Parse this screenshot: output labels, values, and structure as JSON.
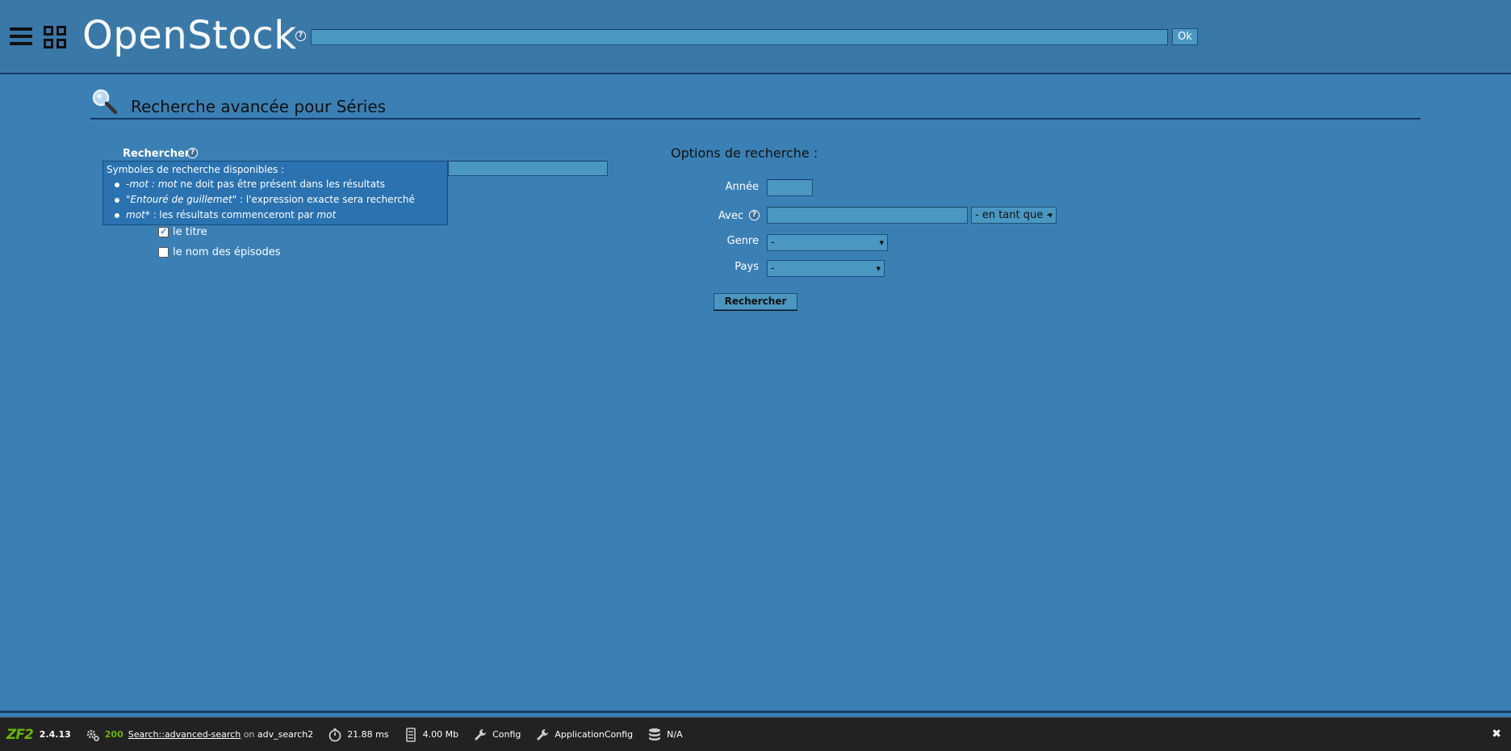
{
  "header": {
    "menu_icon": "hamburger-icon",
    "apps_icon": "grid-icon",
    "brand": "OpenStock",
    "search_value": "",
    "ok_label": "Ok"
  },
  "page": {
    "title": "Recherche avancée pour Séries",
    "title_icon": "magnifier-icon"
  },
  "left": {
    "search_label": "Rechercher",
    "search_value": "",
    "tooltip": {
      "title": "Symboles de recherche disponibles :",
      "items": [
        {
          "em": "-mot : mot",
          "text": " ne doit pas être présent dans les résultats"
        },
        {
          "em": "\"Entouré de guillemet\"",
          "text": " : l'expression exacte sera recherché"
        },
        {
          "em": "mot*",
          "text": " : les résultats commenceront par ",
          "em2": "mot"
        }
      ]
    },
    "checkboxes": [
      {
        "label": "le titre",
        "checked": true
      },
      {
        "label": "le nom des épisodes",
        "checked": false
      }
    ]
  },
  "options": {
    "title": "Options de recherche :",
    "annee_label": "Année",
    "annee_value": "",
    "avec_label": "Avec",
    "avec_value": "",
    "avec_role": "- en tant que -",
    "genre_label": "Genre",
    "genre_value": "-",
    "pays_label": "Pays",
    "pays_value": "-",
    "submit_label": "Rechercher"
  },
  "toolbar": {
    "logo": "ZF2",
    "version": "2.4.13",
    "status": "200",
    "route": "Search::advanced-search",
    "on": "on",
    "action": "adv_search2",
    "time": "21.88 ms",
    "memory": "4.00 Mb",
    "config": "Config",
    "app_config": "ApplicationConfig",
    "db": "N/A",
    "close": "✖"
  },
  "colors": {
    "background": "#3b80b5",
    "header": "#3a78a8",
    "field": "#4a97c2",
    "toolbar": "#222222",
    "zf_green": "#68b604"
  }
}
